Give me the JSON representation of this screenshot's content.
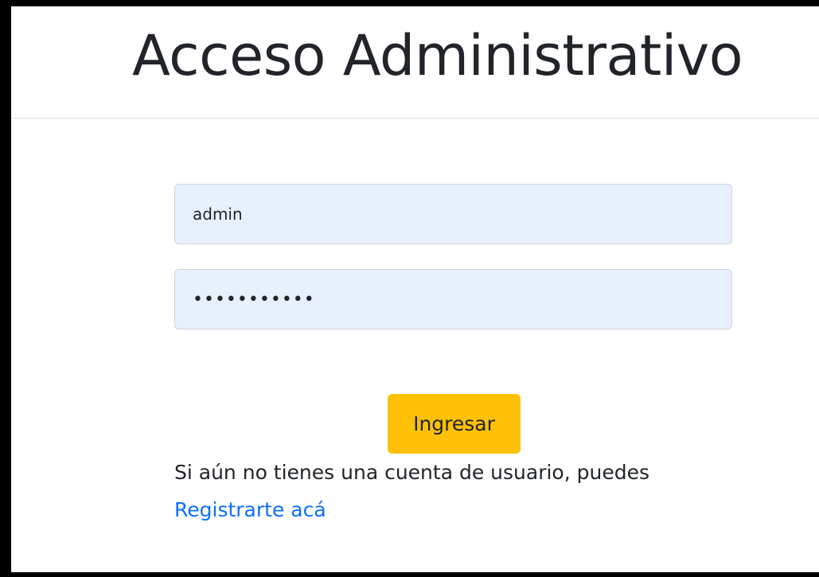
{
  "header": {
    "title": "Acceso Administrativo"
  },
  "login_form": {
    "username_value": "admin",
    "password_value": "•••••••••••",
    "submit_label": "Ingresar"
  },
  "register": {
    "prompt_text": "Si aún no tienes una cuenta de usuario, puedes",
    "link_label": "Registrarte acá"
  },
  "colors": {
    "submit_button": "#ffc107",
    "link": "#0d6efd",
    "input_autofill_bg": "#e8f0fe",
    "frame_border": "#000000"
  }
}
